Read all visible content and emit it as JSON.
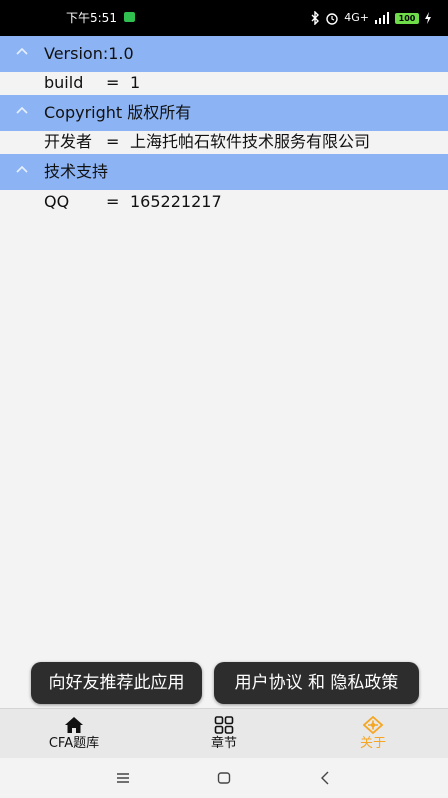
{
  "status_bar": {
    "time": "下午5:51",
    "network": "4G+",
    "battery": "100"
  },
  "sections": [
    {
      "title": "Version:1.0",
      "rows": [
        {
          "key": "build",
          "eq": "=",
          "value": "1"
        }
      ]
    },
    {
      "title": "Copyright 版权所有",
      "rows": [
        {
          "key": "开发者",
          "eq": "=",
          "value": "上海托帕石软件技术服务有限公司"
        }
      ]
    },
    {
      "title": "技术支持",
      "rows": [
        {
          "key": "QQ",
          "eq": "=",
          "value": "165221217"
        }
      ]
    }
  ],
  "buttons": {
    "share": "向好友推荐此应用",
    "agreement": "用户协议 和 隐私政策"
  },
  "tabs": [
    {
      "label": "CFA题库",
      "icon": "home-icon"
    },
    {
      "label": "章节",
      "icon": "grid-icon"
    },
    {
      "label": "关于",
      "icon": "about-icon",
      "active": true
    }
  ],
  "colors": {
    "header_bg": "#8cb4f4",
    "active_tab": "#f5a623",
    "button_bg": "#2d2d2d"
  }
}
